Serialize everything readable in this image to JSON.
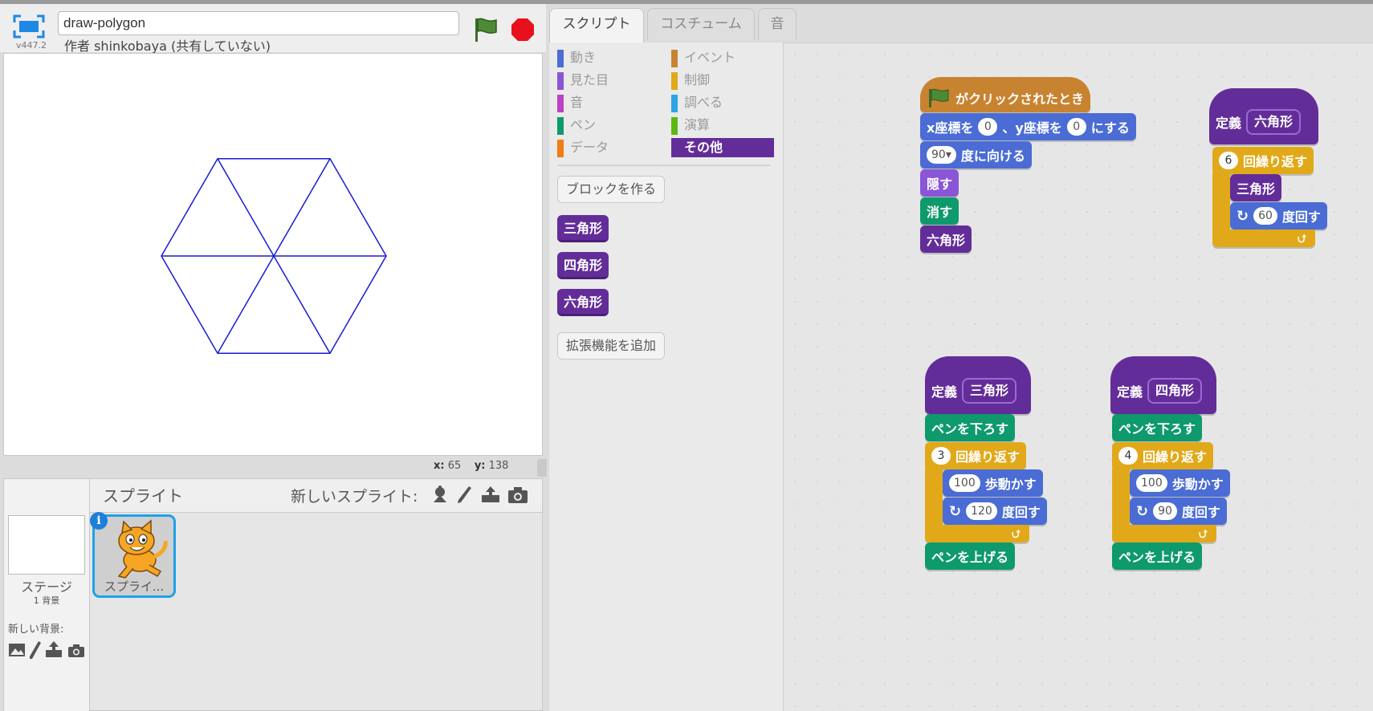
{
  "project": {
    "title": "draw-polygon",
    "version": "v447.2",
    "author_line": "作者 shinkobaya (共有していない)"
  },
  "stage": {
    "x_label": "x:",
    "x_value": "65",
    "y_label": "y:",
    "y_value": "138",
    "pen_color": "#1a1ad6"
  },
  "sprite_pane": {
    "title": "スプライト",
    "new_sprite_label": "新しいスプライト:",
    "stage_label": "ステージ",
    "backdrop_count": "1 背景",
    "new_backdrop_label": "新しい背景:",
    "sprite_name": "スプライ...",
    "info_icon": "i"
  },
  "tabs": [
    {
      "label": "スクリプト"
    },
    {
      "label": "コスチューム"
    },
    {
      "label": "音"
    }
  ],
  "palette": {
    "categories_left": [
      {
        "label": "動き",
        "color": "#4a6cd4"
      },
      {
        "label": "見た目",
        "color": "#8a55d7"
      },
      {
        "label": "音",
        "color": "#bb42c3"
      },
      {
        "label": "ペン",
        "color": "#0e9a6c"
      },
      {
        "label": "データ",
        "color": "#ee7d16"
      }
    ],
    "categories_right": [
      {
        "label": "イベント",
        "color": "#c88330"
      },
      {
        "label": "制御",
        "color": "#e1a91a"
      },
      {
        "label": "調べる",
        "color": "#2ca5e2"
      },
      {
        "label": "演算",
        "color": "#5cb712"
      },
      {
        "label": "その他",
        "color": "#632d99"
      }
    ],
    "make_block": "ブロックを作る",
    "blocks": [
      "三角形",
      "四角形",
      "六角形"
    ],
    "add_extension": "拡張機能を追加"
  },
  "scripts": {
    "main": {
      "hat": "がクリックされたとき",
      "goto_x": "x座標を",
      "x_val": "0",
      "goto_y": "、y座標を",
      "y_val": "0",
      "goto_end": "にする",
      "dir_val": "90",
      "point_label": "度に向ける",
      "hide": "隠す",
      "clear": "消す",
      "call": "六角形"
    },
    "def_hexagon": {
      "define": "定義",
      "name": "六角形",
      "repeat_val": "6",
      "repeat_label": "回繰り返す",
      "call": "三角形",
      "turn_val": "60",
      "turn_label": "度回す"
    },
    "def_triangle": {
      "define": "定義",
      "name": "三角形",
      "pen_down": "ペンを下ろす",
      "repeat_val": "3",
      "repeat_label": "回繰り返す",
      "move_val": "100",
      "move_label": "歩動かす",
      "turn_val": "120",
      "turn_label": "度回す",
      "pen_up": "ペンを上げる"
    },
    "def_square": {
      "define": "定義",
      "name": "四角形",
      "pen_down": "ペンを下ろす",
      "repeat_val": "4",
      "repeat_label": "回繰り返す",
      "move_val": "100",
      "move_label": "歩動かす",
      "turn_val": "90",
      "turn_label": "度回す",
      "pen_up": "ペンを上げる"
    }
  }
}
